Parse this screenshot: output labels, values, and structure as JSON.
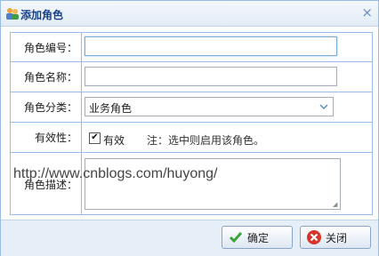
{
  "dialog": {
    "title": "添加角色",
    "close": "×"
  },
  "form": {
    "code_label": "角色编号：",
    "code_value": "",
    "name_label": "角色名称：",
    "name_value": "",
    "category_label": "角色分类：",
    "category_value": "业务角色",
    "valid_label": "有效性：",
    "valid_checkbox_label": "有效",
    "valid_checked": true,
    "valid_note": "注：选中则启用该角色。",
    "desc_label": "角色描述：",
    "desc_value": ""
  },
  "watermark": "http://www.cnblogs.com/huyong/",
  "buttons": {
    "ok": "确定",
    "close": "关闭"
  },
  "colors": {
    "border": "#99bbe8",
    "title": "#15428b",
    "ok_icon": "#3aa33a",
    "close_icon": "#d9342b"
  }
}
